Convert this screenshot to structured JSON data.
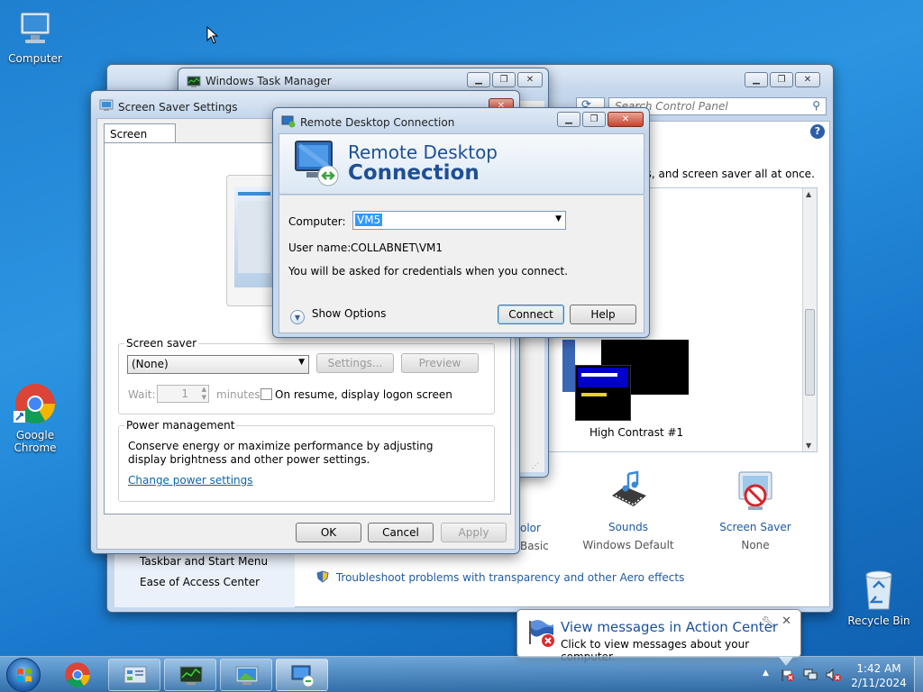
{
  "desktop": {
    "icons": {
      "computer": "Computer",
      "chrome": "Google Chrome",
      "recycle_bin": "Recycle Bin"
    }
  },
  "control_panel": {
    "search_placeholder": "Search Control Panel",
    "intro_fragment": "ds, and screen saver all at once.",
    "theme_label": "High Contrast #1",
    "items": [
      {
        "label": "Sounds",
        "sub": "Windows Default"
      },
      {
        "label": "Screen Saver",
        "sub": "None"
      }
    ],
    "color_fragment": "olor",
    "basic_fragment": "Basic",
    "sidebar": [
      "Taskbar and Start Menu",
      "Ease of Access Center"
    ],
    "troubleshoot": "Troubleshoot problems with transparency and other Aero effects"
  },
  "task_manager": {
    "title": "Windows Task Manager"
  },
  "screen_saver": {
    "title": "Screen Saver Settings",
    "tab": "Screen Saver",
    "group_label": "Screen saver",
    "selected": "(None)",
    "settings_btn": "Settings...",
    "preview_btn": "Preview",
    "wait_label": "Wait:",
    "wait_value": "1",
    "minutes_label": "minutes",
    "resume_label": "On resume, display logon screen",
    "power_label": "Power management",
    "power_text": "Conserve energy or maximize performance by adjusting display brightness and other power settings.",
    "power_link": "Change power settings",
    "ok": "OK",
    "cancel": "Cancel",
    "apply": "Apply"
  },
  "rdc": {
    "title": "Remote Desktop Connection",
    "banner_line1": "Remote Desktop",
    "banner_line2": "Connection",
    "computer_label": "Computer:",
    "computer_value": "VM5",
    "username_label": "User name:",
    "username_value": "COLLABNET\\VM1",
    "info": "You will be asked for credentials when you connect.",
    "show_options": "Show Options",
    "connect": "Connect",
    "help": "Help"
  },
  "notification": {
    "title": "View messages in Action Center",
    "body": "Click to view messages about your computer."
  },
  "clock": {
    "time": "1:42 AM",
    "date": "2/11/2024"
  },
  "colors": {
    "accent": "#1d5aa7",
    "link": "#0b66a8"
  }
}
